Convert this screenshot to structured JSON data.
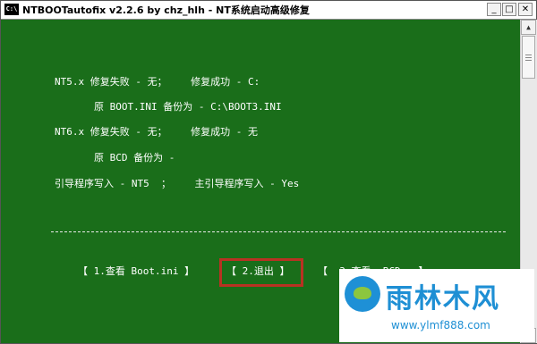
{
  "window": {
    "icon_text": "C:\\",
    "title": "NTBOOTautofix v2.2.6 by chz_hlh - NT系统启动高级修复",
    "minimize": "_",
    "maximize": "□",
    "close": "✕"
  },
  "console": {
    "lines": [
      "NT5.x 修复失败 - 无；    修复成功 - C:",
      "原 BOOT.INI 备份为 - C:\\BOOT3.INI",
      "NT6.x 修复失败 - 无；    修复成功 - 无",
      "原 BCD 备份为 -",
      "引导程序写入 - NT5  ；    主引导程序写入 - Yes"
    ]
  },
  "menu": {
    "items": [
      "【 1.查看 Boot.ini 】",
      "【 2.退出 】",
      "【  3.查看  BCD   】"
    ]
  },
  "scrollbar": {
    "up_icon": "chevron-up-icon",
    "down_icon": "chevron-down-icon"
  },
  "watermark": {
    "logo_icon": "rain-forest-logo",
    "title": "雨林木风",
    "url": "www.ylmf888.com"
  },
  "colors": {
    "console_bg": "#1a6e1a",
    "console_text": "#ffffff",
    "highlight": "#b83222",
    "watermark": "#1e8fd4"
  }
}
